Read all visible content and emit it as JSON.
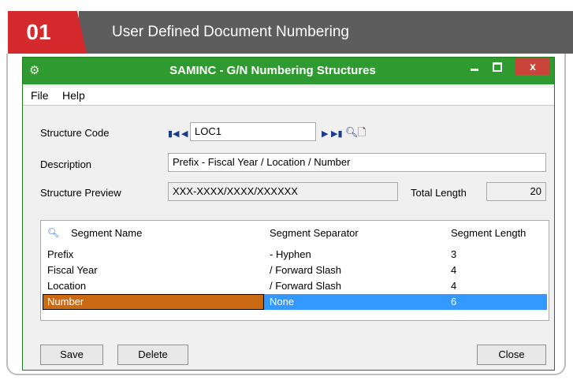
{
  "banner": {
    "number": "01",
    "title": "User Defined Document Numbering"
  },
  "window": {
    "title": "SAMINC - G/N Numbering Structures",
    "close_glyph": "x"
  },
  "menu": {
    "file": "File",
    "help": "Help"
  },
  "form": {
    "structure_code_label": "Structure Code",
    "structure_code_value": "LOC1",
    "description_label": "Description",
    "description_value": "Prefix - Fiscal Year / Location / Number",
    "preview_label": "Structure Preview",
    "preview_value": "XXX-XXXX/XXXX/XXXXXX",
    "total_length_label": "Total Length",
    "total_length_value": "20"
  },
  "grid": {
    "headers": [
      "Segment Name",
      "Segment Separator",
      "Segment Length"
    ],
    "rows": [
      [
        "Prefix",
        "- Hyphen",
        "3"
      ],
      [
        "Fiscal Year",
        "/ Forward Slash",
        "4"
      ],
      [
        "Location",
        "/ Forward Slash",
        "4"
      ],
      [
        "Number",
        "None",
        "6"
      ]
    ],
    "selected_row": 3
  },
  "buttons": {
    "save": "Save",
    "delete": "Delete",
    "close": "Close"
  },
  "colors": {
    "titlebar": "#2f9a2f",
    "banner_red": "#d42a2e",
    "selection": "#3399ff",
    "selected_cell": "#cc6a14"
  }
}
